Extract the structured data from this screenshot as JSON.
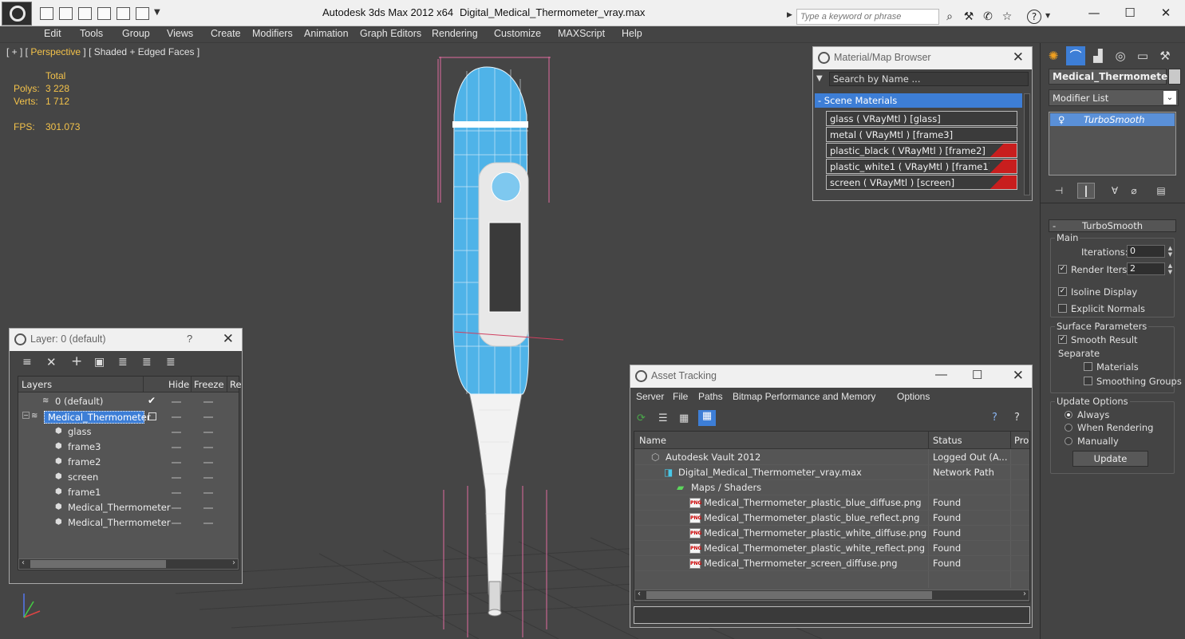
{
  "app": {
    "title": "Autodesk 3ds Max  2012 x64",
    "file": "Digital_Medical_Thermometer_vray.max",
    "search_placeholder": "Type a keyword or phrase"
  },
  "menu": [
    "Edit",
    "Tools",
    "Group",
    "Views",
    "Create",
    "Modifiers",
    "Animation",
    "Graph Editors",
    "Rendering",
    "Customize",
    "MAXScript",
    "Help"
  ],
  "viewport": {
    "label_pre": "[ + ] [ ",
    "label_view": "Perspective",
    "label_post": " ] [ Shaded + Edged Faces ]",
    "stats_header": "Total",
    "polys_label": "Polys:",
    "polys_value": "3 228",
    "verts_label": "Verts:",
    "verts_value": "1 712",
    "fps_label": "FPS:",
    "fps_value": "301.073",
    "body_color": "#4fb3e8",
    "tip_color": "#f2f2f2"
  },
  "material_browser": {
    "title": "Material/Map Browser",
    "search_placeholder": "Search by Name ...",
    "section": "- Scene Materials",
    "materials": [
      {
        "name": "glass  ( VRayMtl )  [glass]",
        "flag": false
      },
      {
        "name": "metal  ( VRayMtl )  [frame3]",
        "flag": false
      },
      {
        "name": "plastic_black  ( VRayMtl )  [frame2]",
        "flag": true
      },
      {
        "name": "plastic_white1  ( VRayMtl )  [frame1]",
        "flag": true
      },
      {
        "name": "screen  ( VRayMtl )  [screen]",
        "flag": true
      }
    ]
  },
  "layer_window": {
    "title": "Layer: 0 (default)",
    "help": "?",
    "headers": {
      "layers": "Layers",
      "hide": "Hide",
      "freeze": "Freeze",
      "render": "Re"
    },
    "rows": [
      {
        "name": "0 (default)",
        "indent": 1,
        "selected": false
      },
      {
        "name": "Medical_Thermometer",
        "indent": 0,
        "selected": true
      },
      {
        "name": "glass",
        "indent": 2,
        "selected": false
      },
      {
        "name": "frame3",
        "indent": 2,
        "selected": false
      },
      {
        "name": "frame2",
        "indent": 2,
        "selected": false
      },
      {
        "name": "screen",
        "indent": 2,
        "selected": false
      },
      {
        "name": "frame1",
        "indent": 2,
        "selected": false
      },
      {
        "name": "Medical_Thermometer",
        "indent": 2,
        "selected": false
      },
      {
        "name": "Medical_Thermometer",
        "indent": 2,
        "selected": false
      }
    ]
  },
  "asset_tracking": {
    "title": "Asset Tracking",
    "menu": [
      "Server",
      "File",
      "Paths",
      "Bitmap Performance and Memory",
      "Options"
    ],
    "headers": {
      "name": "Name",
      "status": "Status",
      "pro": "Pro"
    },
    "rows": [
      {
        "name": "Autodesk Vault 2012",
        "status": "Logged Out (A...",
        "indent": 0,
        "icon": "vault"
      },
      {
        "name": "Digital_Medical_Thermometer_vray.max",
        "status": "Network Path",
        "indent": 1,
        "icon": "max"
      },
      {
        "name": "Maps / Shaders",
        "status": "",
        "indent": 2,
        "icon": "maps"
      },
      {
        "name": "Medical_Thermometer_plastic_blue_diffuse.png",
        "status": "Found",
        "indent": 3,
        "icon": "png"
      },
      {
        "name": "Medical_Thermometer_plastic_blue_reflect.png",
        "status": "Found",
        "indent": 3,
        "icon": "png"
      },
      {
        "name": "Medical_Thermometer_plastic_white_diffuse.png",
        "status": "Found",
        "indent": 3,
        "icon": "png"
      },
      {
        "name": "Medical_Thermometer_plastic_white_reflect.png",
        "status": "Found",
        "indent": 3,
        "icon": "png"
      },
      {
        "name": "Medical_Thermometer_screen_diffuse.png",
        "status": "Found",
        "indent": 3,
        "icon": "png"
      }
    ],
    "png_label": "PNG"
  },
  "command_panel": {
    "object_name": "Medical_Thermometer",
    "modifier_list": "Modifier List",
    "stack_item": "TurboSmooth",
    "rollout": "TurboSmooth",
    "main_label": "Main",
    "iterations_label": "Iterations:",
    "iterations_value": "0",
    "render_iters_label": "Render Iters:",
    "render_iters_value": "2",
    "isoline_label": "Isoline Display",
    "explicit_normals_label": "Explicit Normals",
    "surface_params_label": "Surface Parameters",
    "smooth_result_label": "Smooth Result",
    "separate_label": "Separate",
    "materials_label": "Materials",
    "smoothing_groups_label": "Smoothing Groups",
    "update_options_label": "Update Options",
    "always_label": "Always",
    "when_rendering_label": "When Rendering",
    "manually_label": "Manually",
    "update_button": "Update"
  },
  "colors": {
    "accent": "#3d7ed6",
    "stats": "#f3c24a",
    "flag": "#c81e1e"
  }
}
